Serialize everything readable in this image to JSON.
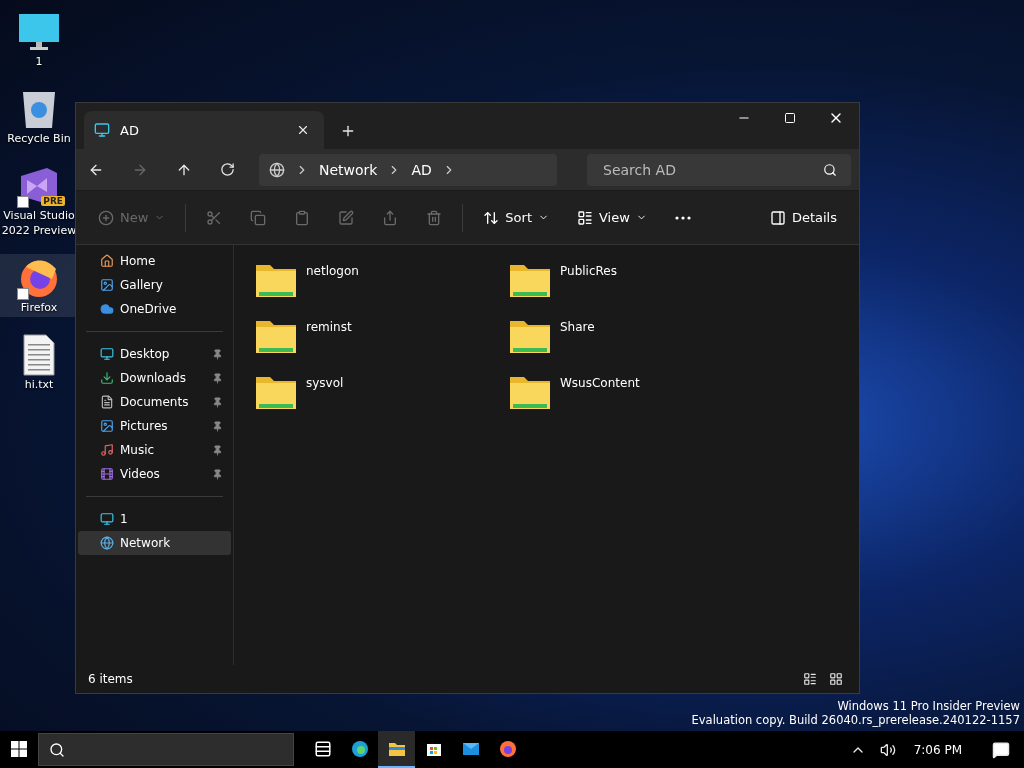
{
  "desktop_icons": [
    {
      "label": "1",
      "kind": "monitor",
      "shortcut": false,
      "selected": false
    },
    {
      "label": "Recycle Bin",
      "kind": "recycle",
      "shortcut": false,
      "selected": false
    },
    {
      "label": "Visual Studio 2022 Preview",
      "kind": "vs",
      "badge": "PRE",
      "shortcut": true,
      "selected": false
    },
    {
      "label": "Firefox",
      "kind": "firefox",
      "shortcut": true,
      "selected": true
    },
    {
      "label": "hi.txt",
      "kind": "text",
      "shortcut": false,
      "selected": false
    }
  ],
  "window": {
    "tab": {
      "title": "AD"
    },
    "address": [
      "Network",
      "AD"
    ],
    "search": {
      "placeholder": "Search AD"
    },
    "toolbar": [
      {
        "kind": "new",
        "label": "New",
        "disabled": true
      },
      {
        "kind": "cut",
        "disabled": true
      },
      {
        "kind": "copy",
        "disabled": true
      },
      {
        "kind": "paste",
        "disabled": true
      },
      {
        "kind": "rename",
        "disabled": true
      },
      {
        "kind": "share",
        "disabled": true
      },
      {
        "kind": "delete",
        "disabled": true
      },
      {
        "kind": "sort",
        "label": "Sort",
        "disabled": false
      },
      {
        "kind": "view",
        "label": "View",
        "disabled": false
      },
      {
        "kind": "more",
        "disabled": false
      },
      {
        "kind": "details",
        "label": "Details",
        "disabled": false
      }
    ],
    "sidebar": {
      "groups": [
        [
          {
            "label": "Home",
            "kind": "home",
            "pinned": false,
            "selected": false
          },
          {
            "label": "Gallery",
            "kind": "gallery",
            "pinned": false,
            "selected": false
          },
          {
            "label": "OneDrive",
            "kind": "cloud",
            "pinned": false,
            "selected": false
          }
        ],
        [
          {
            "label": "Desktop",
            "kind": "desktop",
            "pinned": true,
            "selected": false
          },
          {
            "label": "Downloads",
            "kind": "download",
            "pinned": true,
            "selected": false
          },
          {
            "label": "Documents",
            "kind": "document",
            "pinned": true,
            "selected": false
          },
          {
            "label": "Pictures",
            "kind": "picture",
            "pinned": true,
            "selected": false
          },
          {
            "label": "Music",
            "kind": "music",
            "pinned": true,
            "selected": false
          },
          {
            "label": "Videos",
            "kind": "video",
            "pinned": true,
            "selected": false
          }
        ],
        [
          {
            "label": "1",
            "kind": "monitor",
            "pinned": false,
            "selected": false
          },
          {
            "label": "Network",
            "kind": "network",
            "pinned": false,
            "selected": true
          }
        ]
      ]
    },
    "folders": [
      "netlogon",
      "PublicRes",
      "reminst",
      "Share",
      "sysvol",
      "WsusContent"
    ],
    "status_bar": {
      "count": "6 items"
    }
  },
  "watermark": [
    "Windows 11 Pro Insider Preview",
    "Evaluation copy. Build 26040.rs_prerelease.240122-1157"
  ],
  "taskbar": {
    "apps": [
      {
        "kind": "taskview",
        "active": false
      },
      {
        "kind": "edge",
        "active": false
      },
      {
        "kind": "explorer",
        "active": true
      },
      {
        "kind": "store",
        "active": false
      },
      {
        "kind": "mail",
        "active": false
      },
      {
        "kind": "firefox",
        "active": false
      }
    ],
    "time": "7:06 PM"
  }
}
